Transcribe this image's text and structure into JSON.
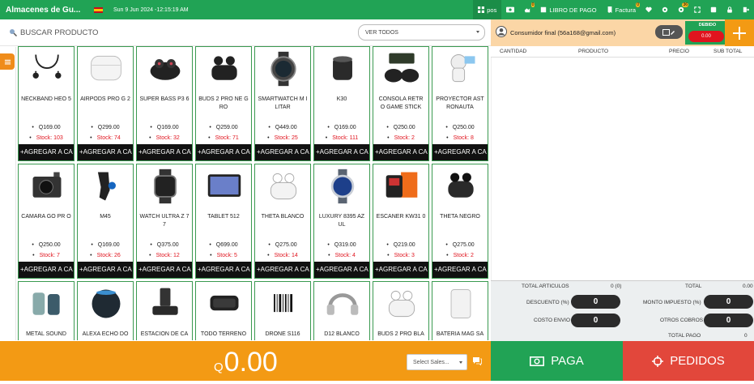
{
  "app": {
    "brand": "Almacenes de Gu...",
    "datetime": "Sun 9 Jun 2024 -12:15:19 AM",
    "flag": "spain-flag"
  },
  "topnav": {
    "pos_label": "pos",
    "libro_label": "LIBRO DE PAGO",
    "factura_label": "Factura",
    "badges": {
      "hand": "0",
      "factura": "0",
      "gear": "36"
    }
  },
  "search": {
    "placeholder": "BUSCAR PRODUCTO",
    "filter_value": "VER TODOS"
  },
  "products": [
    {
      "name": "NECKBAND HEO 5",
      "price": "Q169.00",
      "stock": "Stock: 103",
      "icon": "earphones-icon"
    },
    {
      "name": "AIRPODS PRO G 2",
      "price": "Q299.00",
      "stock": "Stock: 74",
      "icon": "airpods-icon"
    },
    {
      "name": "SUPER BASS P3 6",
      "price": "Q169.00",
      "stock": "Stock: 32",
      "icon": "earbuds-case-icon"
    },
    {
      "name": "BUDS 2 PRO NE GRO",
      "price": "Q259.00",
      "stock": "Stock: 71",
      "icon": "earbuds-icon"
    },
    {
      "name": "SMARTWATCH M ILITAR",
      "price": "Q449.00",
      "stock": "Stock: 25",
      "icon": "watch-round-icon"
    },
    {
      "name": "K30",
      "price": "Q169.00",
      "stock": "Stock: 111",
      "icon": "speaker-icon"
    },
    {
      "name": "CONSOLA RETR O GAME STICK",
      "price": "Q250.00",
      "stock": "Stock: 2",
      "icon": "gamepad-icon"
    },
    {
      "name": "PROYECTOR AST RONAUTA",
      "price": "Q250.00",
      "stock": "Stock: 8",
      "icon": "astronaut-icon"
    },
    {
      "name": "CAMARA GO PR O",
      "price": "Q250.00",
      "stock": "Stock: 7",
      "icon": "camera-icon"
    },
    {
      "name": "M45",
      "price": "Q169.00",
      "stock": "Stock: 26",
      "icon": "earbud-icon"
    },
    {
      "name": "WATCH ULTRA Z 77",
      "price": "Q375.00",
      "stock": "Stock: 12",
      "icon": "watch-square-icon"
    },
    {
      "name": "TABLET 512",
      "price": "Q699.00",
      "stock": "Stock: 5",
      "icon": "tablet-icon"
    },
    {
      "name": "THETA BLANCO",
      "price": "Q275.00",
      "stock": "Stock: 14",
      "icon": "earbuds-white-icon"
    },
    {
      "name": "LUXURY 8395 AZ UL",
      "price": "Q319.00",
      "stock": "Stock: 4",
      "icon": "watch-luxury-icon"
    },
    {
      "name": "ESCANER KW31 0",
      "price": "Q219.00",
      "stock": "Stock: 3",
      "icon": "scanner-icon"
    },
    {
      "name": "THETA NEGRO",
      "price": "Q275.00",
      "stock": "Stock: 2",
      "icon": "earbuds-black-icon"
    },
    {
      "name": "METAL SOUND",
      "price": "",
      "stock": "",
      "icon": "earbuds-metal-icon"
    },
    {
      "name": "ALEXA ECHO DO",
      "price": "",
      "stock": "",
      "icon": "smart-speaker-icon"
    },
    {
      "name": "ESTACION DE CA",
      "price": "",
      "stock": "",
      "icon": "charging-station-icon"
    },
    {
      "name": "TODO TERRENO",
      "price": "",
      "stock": "",
      "icon": "bluetooth-speaker-icon"
    },
    {
      "name": "DRONE S116",
      "price": "",
      "stock": "",
      "icon": "barcode-icon"
    },
    {
      "name": "D12 BLANCO",
      "price": "",
      "stock": "",
      "icon": "headphones-icon"
    },
    {
      "name": "BUDS 2 PRO BLA",
      "price": "",
      "stock": "",
      "icon": "earbuds-white-icon"
    },
    {
      "name": "BATERIA MAG SA",
      "price": "",
      "stock": "",
      "icon": "powerbank-icon"
    }
  ],
  "add_button_label": "+AGREGAR A CA",
  "total": {
    "currency": "Q",
    "amount": "0.00"
  },
  "sales_select": {
    "value": "Select Sales..."
  },
  "client": {
    "name": "Consumidor final (56a168@gmail.com)"
  },
  "debito": {
    "label": "DEBIDO",
    "value": "0.00"
  },
  "cart_columns": [
    "CANTIDAD",
    "PRODUCTO",
    "PRECIO",
    "SUB TOTAL"
  ],
  "summary": {
    "total_articulos_label": "TOTAL ARTICULOS",
    "total_articulos_value": "0 (0)",
    "total_label": "TOTAL",
    "total_value": "0.00",
    "descuento_label": "DESCUENTO (%)",
    "descuento_value": "0",
    "monto_impuesto_label": "MONTO IMPUESTO (%)",
    "monto_impuesto_value": "0",
    "costo_envio_label": "COSTO ENVIO",
    "costo_envio_value": "0",
    "otros_cobros_label": "OTROS COBROS",
    "otros_cobros_value": "0",
    "total_pago_label": "TOTAL PAGO",
    "total_pago_value": "0"
  },
  "actions": {
    "paga_label": "PAGA",
    "pedidos_label": "PEDIDOS"
  },
  "colors": {
    "green": "#21a355",
    "orange": "#f39a14",
    "red": "#e2473b",
    "dark": "#111111"
  }
}
